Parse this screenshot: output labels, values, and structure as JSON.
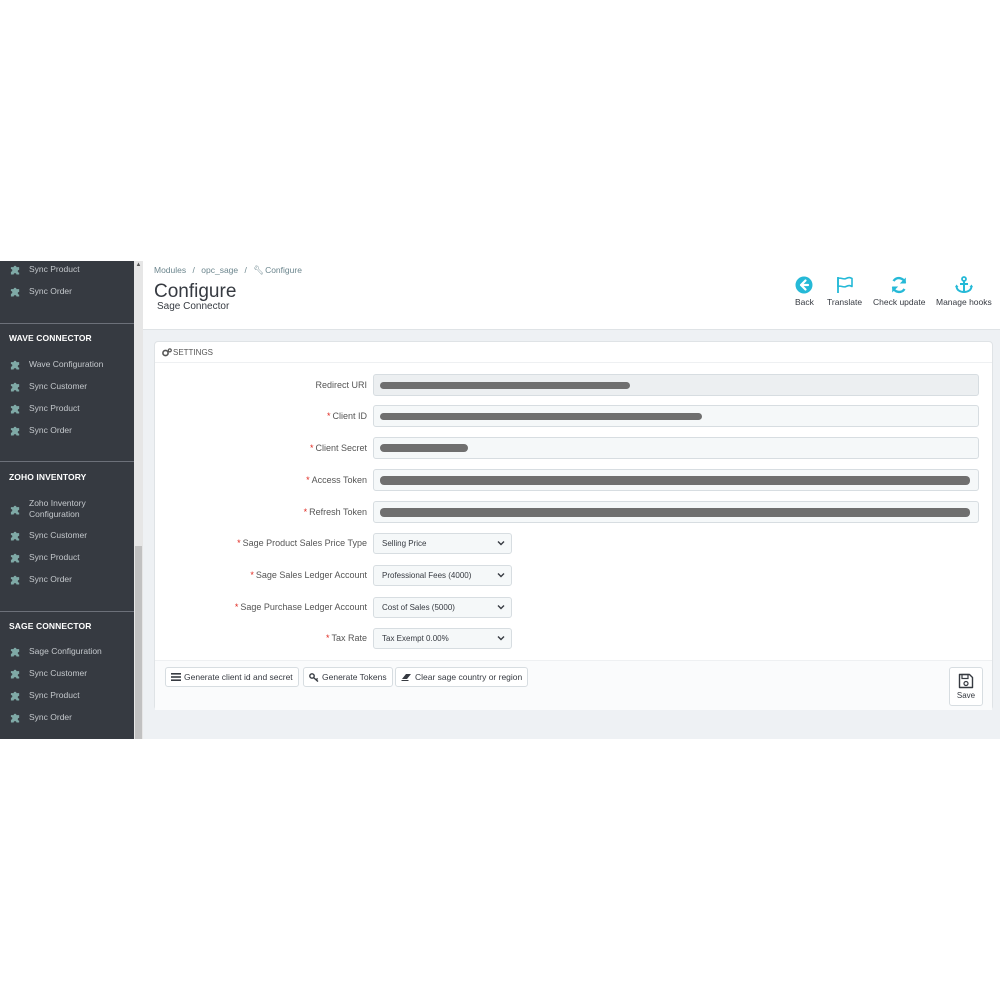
{
  "sidebar": {
    "top_items": [
      {
        "label": "Sync Product"
      },
      {
        "label": "Sync Order"
      }
    ],
    "sections": [
      {
        "title": "WAVE CONNECTOR",
        "items": [
          {
            "label": "Wave Configuration"
          },
          {
            "label": "Sync Customer"
          },
          {
            "label": "Sync Product"
          },
          {
            "label": "Sync Order"
          }
        ]
      },
      {
        "title": "ZOHO INVENTORY",
        "items": [
          {
            "label": "Zoho Inventory",
            "label2": "Configuration"
          },
          {
            "label": "Sync Customer"
          },
          {
            "label": "Sync Product"
          },
          {
            "label": "Sync Order"
          }
        ]
      },
      {
        "title": "SAGE CONNECTOR",
        "items": [
          {
            "label": "Sage Configuration"
          },
          {
            "label": "Sync Customer"
          },
          {
            "label": "Sync Product"
          },
          {
            "label": "Sync Order"
          }
        ]
      }
    ]
  },
  "breadcrumb": {
    "modules": "Modules",
    "sep": "/",
    "module": "opc_sage",
    "current": "Configure"
  },
  "header": {
    "title": "Configure",
    "subtitle": "Sage Connector"
  },
  "toolbar": {
    "back": "Back",
    "translate": "Translate",
    "check_update": "Check update",
    "manage_hooks": "Manage hooks"
  },
  "panel": {
    "heading": "SETTINGS",
    "fields": {
      "redirect_uri": {
        "label": "Redirect URI",
        "required": false
      },
      "client_id": {
        "label": "Client ID",
        "required": true
      },
      "client_secret": {
        "label": "Client Secret",
        "required": true
      },
      "access_token": {
        "label": "Access Token",
        "required": true
      },
      "refresh_token": {
        "label": "Refresh Token",
        "required": true
      },
      "price_type": {
        "label": "Sage Product Sales Price Type",
        "required": true,
        "value": "Selling Price"
      },
      "sales_ledger": {
        "label": "Sage Sales Ledger Account",
        "required": true,
        "value": "Professional Fees (4000)"
      },
      "purchase_ledger": {
        "label": "Sage Purchase Ledger Account",
        "required": true,
        "value": "Cost of Sales (5000)"
      },
      "tax_rate": {
        "label": "Tax Rate",
        "required": true,
        "value": "Tax Exempt 0.00%"
      }
    },
    "required_mark": "*",
    "buttons": {
      "generate_client": "Generate client id and secret",
      "generate_tokens": "Generate Tokens",
      "clear_country": "Clear sage country or region",
      "save": "Save"
    }
  },
  "colors": {
    "sidebar_bg": "#363a41",
    "accent": "#25b9d7",
    "required": "#e0271f"
  },
  "icons": {
    "nav": "puzzle-icon",
    "back": "arrow-left-circle-icon",
    "translate": "flag-icon",
    "check_update": "refresh-icon",
    "manage_hooks": "anchor-icon",
    "settings": "cogs-icon",
    "save": "floppy-disk-icon"
  }
}
